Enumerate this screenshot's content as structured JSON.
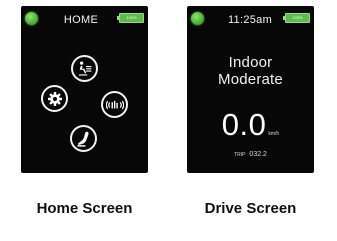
{
  "home_screen": {
    "header": {
      "title": "HOME",
      "battery_label": "100%",
      "status_color": "#4caf50"
    },
    "buttons": [
      {
        "id": "seating",
        "icon": "seating-icon"
      },
      {
        "id": "settings",
        "icon": "gear-icon"
      },
      {
        "id": "wireless",
        "icon": "wireless-icon"
      },
      {
        "id": "drive",
        "icon": "joystick-icon"
      }
    ],
    "caption": "Home Screen"
  },
  "drive_screen": {
    "header": {
      "time": "11:25am",
      "battery_label": "100%",
      "status_color": "#4caf50"
    },
    "mode": {
      "line1": "Indoor",
      "line2": "Moderate"
    },
    "speed": {
      "value": "0.0",
      "unit": "km/h"
    },
    "trip": {
      "label": "TRIP",
      "value": "032.2"
    },
    "caption": "Drive Screen"
  }
}
